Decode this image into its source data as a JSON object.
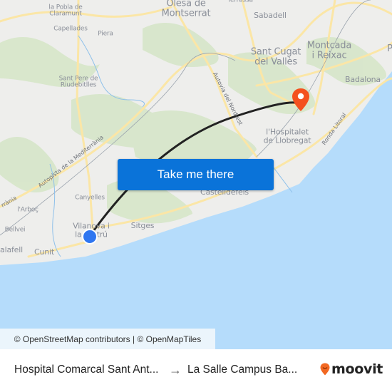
{
  "map": {
    "places": [
      {
        "name": "la Pobla de Claramunt",
        "lines": [
          "la Pobla de",
          "Claramunt"
        ]
      },
      {
        "name": "Olesa de Montserrat",
        "lines": [
          "Olesa de",
          "Montserrat"
        ]
      },
      {
        "name": "Terrassa",
        "lines": [
          "Terrassa"
        ]
      },
      {
        "name": "Sabadell",
        "lines": [
          "Sabadell"
        ]
      },
      {
        "name": "Capellades",
        "lines": [
          "Capellades"
        ]
      },
      {
        "name": "Piera",
        "lines": [
          "Piera"
        ]
      },
      {
        "name": "Montcada i Reixac",
        "lines": [
          "Montcada",
          "i Reixac"
        ]
      },
      {
        "name": "Sant Cugat del Vallès",
        "lines": [
          "Sant Cugat",
          "del Vallès"
        ]
      },
      {
        "name": "Sant Pere de Riudebitlles",
        "lines": [
          "Sant Pere de",
          "Riudebitlles"
        ]
      },
      {
        "name": "Badalona",
        "lines": [
          "Badalona"
        ]
      },
      {
        "name": "l'Hospitalet de Llobregat",
        "lines": [
          "l'Hospitalet",
          "de Llobregat"
        ]
      },
      {
        "name": "Canyelles",
        "lines": [
          "Canyelles"
        ]
      },
      {
        "name": "l'Arboç",
        "lines": [
          "l'Arboç"
        ]
      },
      {
        "name": "Vilanova i la Geltrú",
        "lines": [
          "Vilanova i",
          "la Geltrú"
        ]
      },
      {
        "name": "Sitges",
        "lines": [
          "Sitges"
        ]
      },
      {
        "name": "Bellvei",
        "lines": [
          "Bellvei"
        ]
      },
      {
        "name": "Calafell",
        "lines": [
          "alafell"
        ]
      },
      {
        "name": "Cunit",
        "lines": [
          "Cunit"
        ]
      },
      {
        "name": "Castelldefels",
        "lines": [
          "Castelldefels"
        ]
      },
      {
        "name": "P",
        "lines": [
          "P"
        ]
      }
    ],
    "roads": {
      "autopista": "Autopista de la Mediterrània",
      "autopista_left": "rrània",
      "autovia": "Autovia del Nord-est",
      "ronda": "Ronda Litoral"
    },
    "origin": {
      "label": "Hospital Comarcal Sant Antoni Abat",
      "color": "#2f76f0"
    },
    "destination": {
      "label": "La Salle Campus Barcelona",
      "color": "#f4511e"
    },
    "route_color": "#222222"
  },
  "cta": {
    "label": "Take me there",
    "color": "#0a73d9"
  },
  "attribution": "© OpenStreetMap contributors | © OpenMapTiles",
  "footer": {
    "from": "Hospital Comarcal Sant Ant...",
    "arrow": "→",
    "to": "La Salle Campus Ba...",
    "brand": "moovit",
    "brand_color": "#f26822"
  }
}
